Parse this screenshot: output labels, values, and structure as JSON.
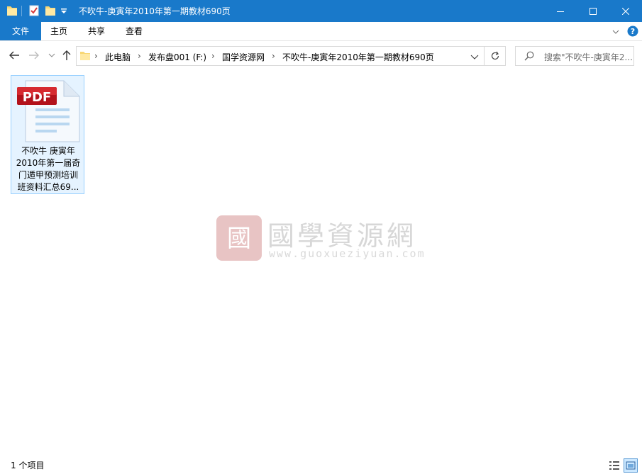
{
  "window": {
    "title": "不吹牛-庚寅年2010年第一期教材690页",
    "accent_color": "#1979ca"
  },
  "ribbon": {
    "tabs": [
      "文件",
      "主页",
      "共享",
      "查看"
    ]
  },
  "address": {
    "crumbs": [
      "此电脑",
      "发布盘001 (F:)",
      "国学资源网",
      "不吹牛-庚寅年2010年第一期教材690页"
    ]
  },
  "search": {
    "placeholder": "搜索\"不吹牛-庚寅年2..."
  },
  "files": [
    {
      "icon": "pdf-file-icon",
      "name": "不吹牛 庚寅年2010年第一届奇门遁甲预测培训班资料汇总69...",
      "name_lines": [
        "不吹牛 庚寅年",
        "2010年第一届奇",
        "门遁甲预测培训",
        "班资料汇总69..."
      ]
    }
  ],
  "watermark": {
    "title": "國學資源網",
    "url": "www.guoxueziyuan.com"
  },
  "status": {
    "item_count": "1 个项目"
  }
}
